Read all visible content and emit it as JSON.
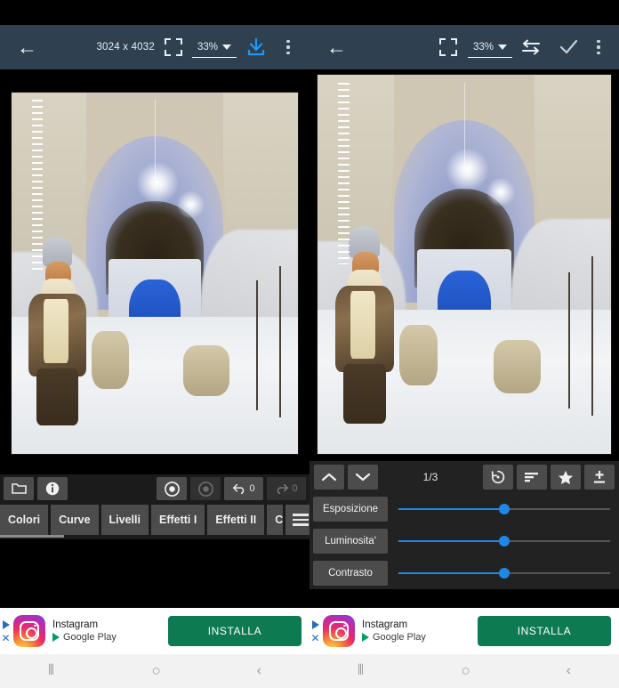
{
  "app": {
    "left_panel": {
      "toolbar": {
        "back_icon": "back-arrow-icon",
        "dimensions": "3024 x 4032",
        "fullscreen_icon": "fullscreen-icon",
        "zoom_value": "33%",
        "download_icon": "download-icon",
        "overflow_icon": "kebab-menu-icon"
      },
      "controls": {
        "folder_label": "▱",
        "info_label": "i",
        "target_active_label": "◎",
        "target_dim_label": "◎",
        "undo_count": "0",
        "redo_count": "0"
      },
      "tabs": [
        {
          "label": "Colori"
        },
        {
          "label": "Curve"
        },
        {
          "label": "Livelli"
        },
        {
          "label": "Effetti I"
        },
        {
          "label": "Effetti II"
        },
        {
          "label": "Cornici"
        }
      ],
      "menu_icon": "hamburger-menu-icon"
    },
    "right_panel": {
      "toolbar": {
        "back_icon": "back-arrow-icon",
        "fullscreen_icon": "fullscreen-icon",
        "zoom_value": "33%",
        "compare_icon": "swap-arrows-icon",
        "confirm_icon": "checkmark-icon",
        "overflow_icon": "kebab-menu-icon"
      },
      "adjust_header": {
        "up_label": "∧",
        "down_label": "∨",
        "page_indicator": "1/3",
        "reset_icon": "history-reset-icon",
        "levels_icon": "levels-sort-icon",
        "favorite_icon": "star-icon",
        "plusminus_icon": "plus-minus-icon"
      },
      "sliders": [
        {
          "label": "Esposizione",
          "value": 50
        },
        {
          "label": "Luminosita'",
          "value": 50
        },
        {
          "label": "Contrasto",
          "value": 50
        }
      ]
    },
    "ad": {
      "adchoices_icon": "adchoices-icon",
      "close_icon": "close-icon",
      "app_icon": "instagram-icon",
      "title": "Instagram",
      "store": "Google Play",
      "cta": "INSTALLA"
    },
    "navbar": {
      "recents_label": "⦀",
      "home_label": "○",
      "back_label": "‹"
    },
    "colors": {
      "toolbar_bg": "#2f4150",
      "accent_blue": "#1e88e5",
      "download_blue": "#2196f3",
      "panel_bg": "#222222",
      "button_gray": "#4c4c4c",
      "cta_green": "#0d7a52"
    }
  }
}
